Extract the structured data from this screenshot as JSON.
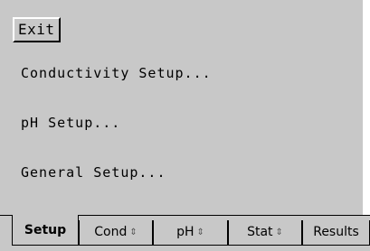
{
  "exit_button": {
    "label": "Exit"
  },
  "menu": {
    "conductivity_setup": "Conductivity Setup...",
    "ph_setup": "pH Setup...",
    "general_setup": "General Setup..."
  },
  "tabs": [
    {
      "label": "Setup",
      "active": true,
      "arrows": ""
    },
    {
      "label": "Cond",
      "active": false,
      "arrows": "⇕"
    },
    {
      "label": "pH",
      "active": false,
      "arrows": "⇕"
    },
    {
      "label": "Stat",
      "active": false,
      "arrows": "⇕"
    },
    {
      "label": "Results",
      "active": false,
      "arrows": ""
    }
  ]
}
